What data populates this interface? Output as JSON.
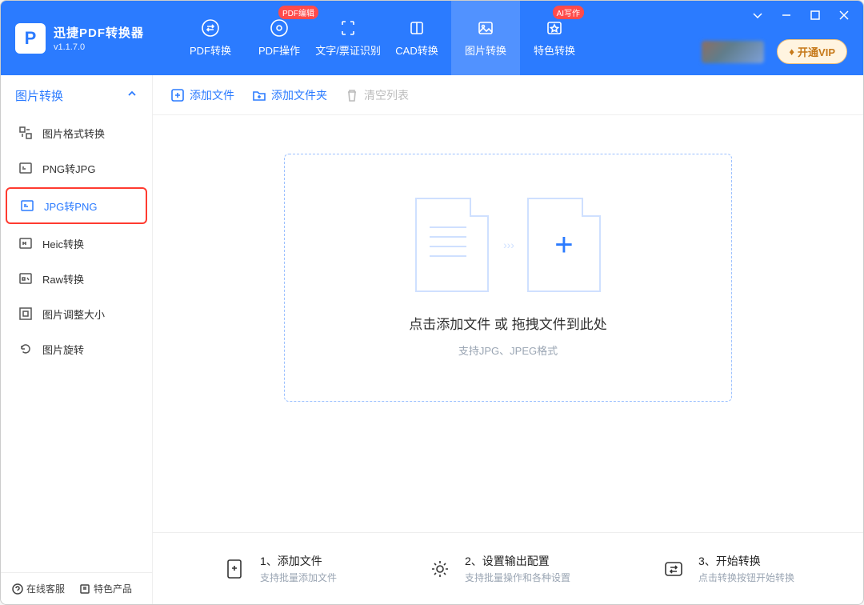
{
  "app": {
    "name": "迅捷PDF转换器",
    "version": "v1.1.7.0"
  },
  "nav": {
    "items": [
      {
        "label": "PDF转换",
        "badge": ""
      },
      {
        "label": "PDF操作",
        "badge": "PDF编辑"
      },
      {
        "label": "文字/票证识别",
        "badge": ""
      },
      {
        "label": "CAD转换",
        "badge": ""
      },
      {
        "label": "图片转换",
        "badge": ""
      },
      {
        "label": "特色转换",
        "badge": "AI写作"
      }
    ]
  },
  "vip_label": "开通VIP",
  "sidebar": {
    "title": "图片转换",
    "items": [
      {
        "label": "图片格式转换"
      },
      {
        "label": "PNG转JPG"
      },
      {
        "label": "JPG转PNG"
      },
      {
        "label": "Heic转换"
      },
      {
        "label": "Raw转换"
      },
      {
        "label": "图片调整大小"
      },
      {
        "label": "图片旋转"
      }
    ],
    "footer": {
      "support": "在线客服",
      "featured": "特色产品"
    }
  },
  "toolbar": {
    "add_file": "添加文件",
    "add_folder": "添加文件夹",
    "clear_list": "清空列表"
  },
  "drop": {
    "line1": "点击添加文件 或 拖拽文件到此处",
    "line2": "支持JPG、JPEG格式"
  },
  "steps": [
    {
      "title": "1、添加文件",
      "sub": "支持批量添加文件"
    },
    {
      "title": "2、设置输出配置",
      "sub": "支持批量操作和各种设置"
    },
    {
      "title": "3、开始转换",
      "sub": "点击转换按钮开始转换"
    }
  ]
}
